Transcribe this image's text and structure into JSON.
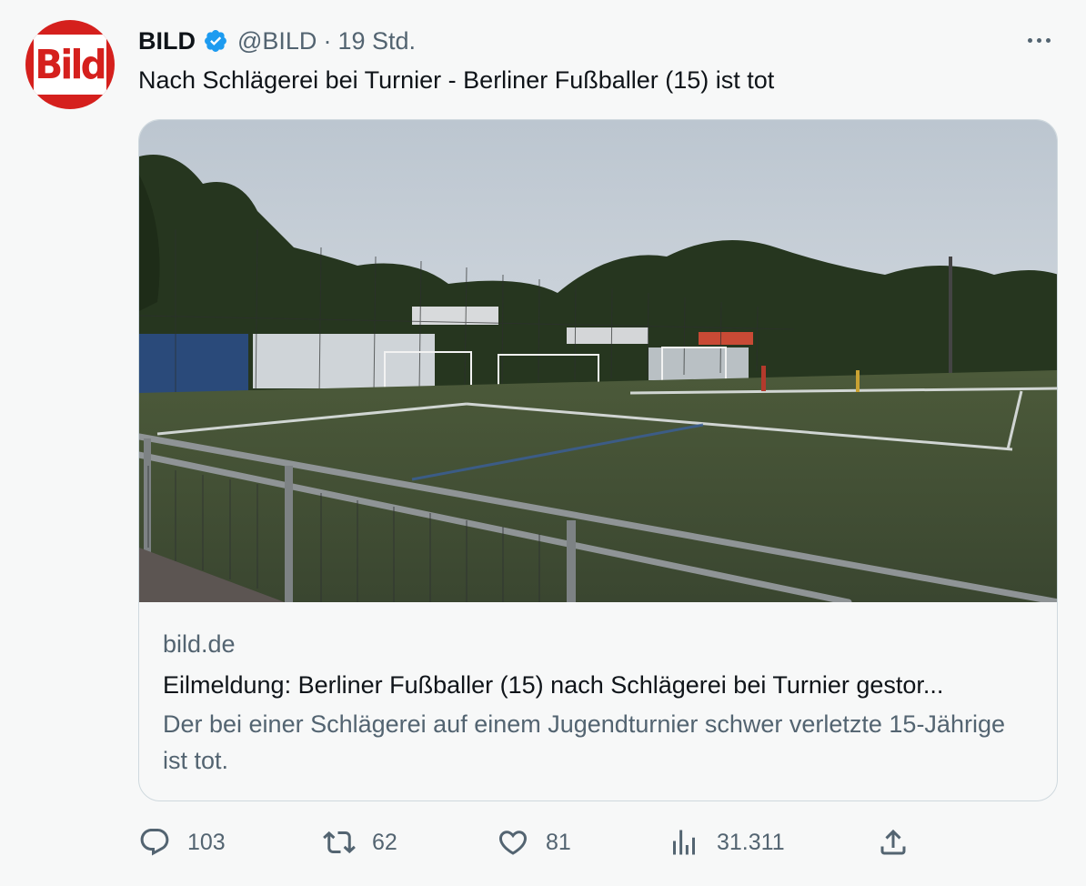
{
  "colors": {
    "brand": "#d5201d",
    "verified": "#1d9bf0",
    "muted": "#536471",
    "text": "#0f1419"
  },
  "tweet": {
    "author": {
      "name": "BILD",
      "handle": "@BILD",
      "separator": "·",
      "time": "19 Std.",
      "avatar_logo_text": "Bild",
      "verified_icon": "verified-badge-icon"
    },
    "more_icon": "more-horizontal-icon",
    "text": "Nach Schlägerei bei Turnier - Berliner Fußballer (15) ist tot"
  },
  "card": {
    "image_subject": "soccer-field-photo",
    "domain": "bild.de",
    "title": "Eilmeldung: Berliner Fußballer (15) nach Schlägerei bei Turnier gestor...",
    "description": "Der bei einer Schlägerei auf einem Jugendturnier schwer verletzte 15-Jährige ist tot."
  },
  "actions": {
    "reply": {
      "icon": "reply-icon",
      "count": "103"
    },
    "retweet": {
      "icon": "retweet-icon",
      "count": "62"
    },
    "like": {
      "icon": "heart-icon",
      "count": "81"
    },
    "views": {
      "icon": "views-chart-icon",
      "count": "31.311"
    },
    "share": {
      "icon": "share-icon"
    }
  }
}
